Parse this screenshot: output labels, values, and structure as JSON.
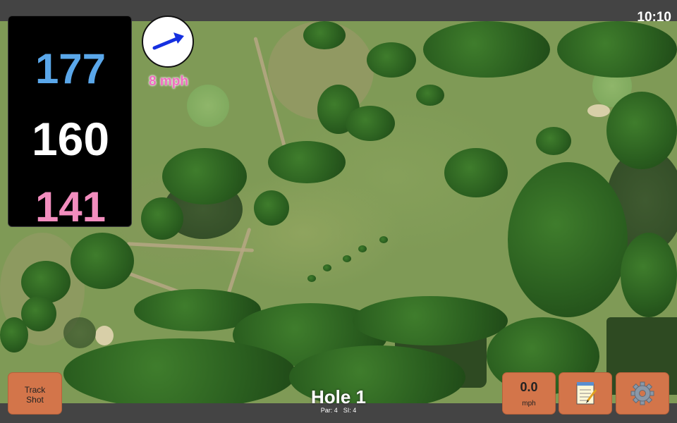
{
  "status": {
    "time": "10:10"
  },
  "distances": {
    "back": "177",
    "middle": "160",
    "front": "141"
  },
  "wind": {
    "speed_text": "8 mph",
    "arrow_color": "#1530e0",
    "label_color": "#f06bc0"
  },
  "hole": {
    "title": "Hole 1",
    "par_text": "Par: 4",
    "si_text": "SI: 4"
  },
  "buttons": {
    "track_line1": "Track",
    "track_line2": "Shot",
    "speed_value": "0.0",
    "speed_unit": "mph",
    "notes_icon": "notepad-icon",
    "settings_icon": "gear-icon"
  },
  "colors": {
    "button_bg": "#d3754a",
    "back_distance": "#5aa7ea",
    "middle_distance": "#ffffff",
    "front_distance": "#f28dbe",
    "bar": "#444444"
  }
}
